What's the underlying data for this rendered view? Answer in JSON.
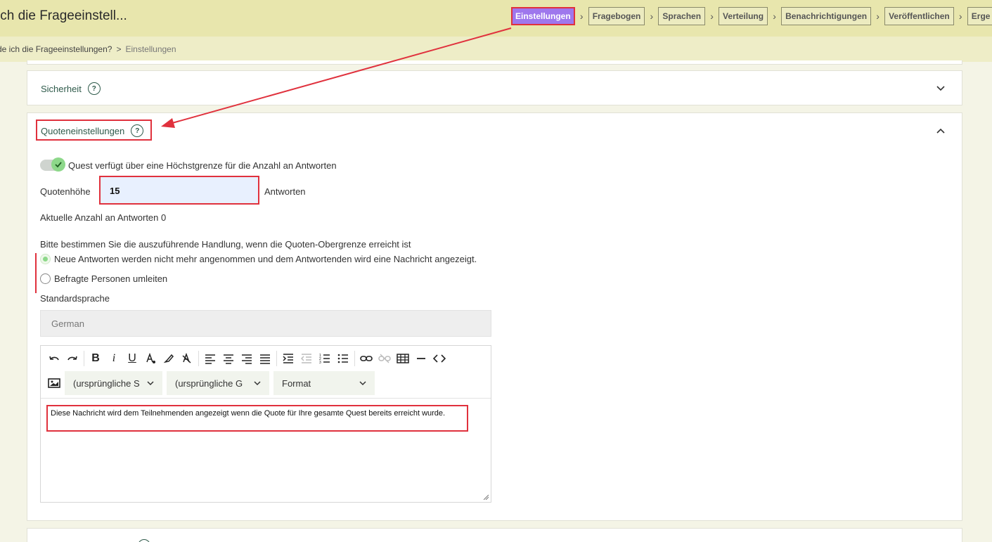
{
  "header": {
    "title": "ich die Frageeinstell...",
    "steps": [
      "Einstellungen",
      "Fragebogen",
      "Sprachen",
      "Verteilung",
      "Benachrichtigungen",
      "Veröffentlichen",
      "Erge"
    ],
    "active_step": "Einstellungen"
  },
  "breadcrumb": {
    "parent": "de ich die Frageeinstellungen?",
    "separator": ">",
    "current": "Einstellungen"
  },
  "sicherheit": {
    "title": "Sicherheit",
    "help": "?"
  },
  "quote": {
    "title": "Quoteneinstellungen",
    "help": "?",
    "toggle_label": "Quest verfügt über eine Höchstgrenze für die Anzahl an Antworten",
    "toggle_on": true,
    "quota_label": "Quotenhöhe",
    "quota_value": "15",
    "quota_unit": "Antworten",
    "current_count": "Aktuelle Anzahl an Antworten 0",
    "action_prompt": "Bitte bestimmen Sie die auszuführende Handlung, wenn die Quoten-Obergrenze erreicht ist",
    "options": [
      "Neue Antworten werden nicht mehr angenommen und dem Antwortenden wird eine Nachricht angezeigt.",
      "Befragte Personen umleiten"
    ],
    "selected_option": 0,
    "language_label": "Standardsprache",
    "language_value": "German"
  },
  "editor": {
    "font_select": "(ursprüngliche S",
    "size_select": "(ursprüngliche G",
    "format_select": "Format",
    "message": "Diese Nachricht wird dem Teilnehmenden angezeigt wenn die Quote für Ihre gesamte Quest bereits erreicht wurde."
  },
  "colors": {
    "accent_active": "#9e77ed",
    "annotation_red": "#e0313d",
    "toggle_green": "#8dd88a",
    "header_bg": "#e8e6ad"
  }
}
